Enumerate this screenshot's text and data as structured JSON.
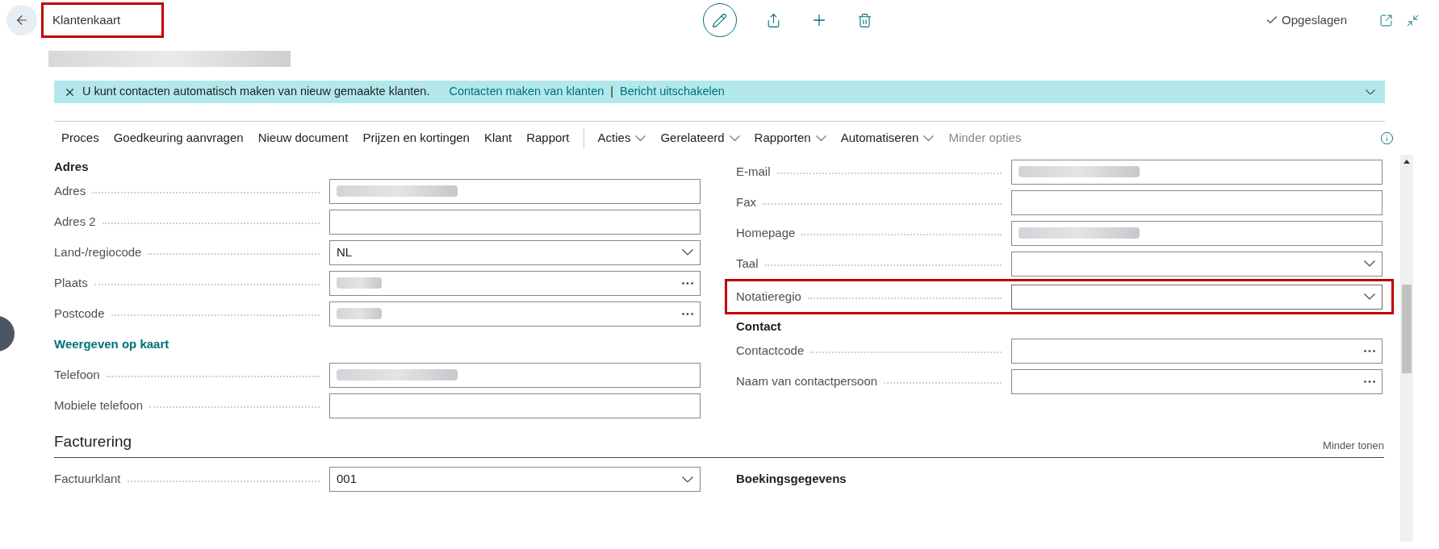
{
  "header": {
    "title": "Klantenkaart",
    "title_highlighted": true,
    "status": "Opgeslagen"
  },
  "notification": {
    "message": "U kunt contacten automatisch maken van nieuw gemaakte klanten.",
    "links": [
      "Contacten maken van klanten",
      "Bericht uitschakelen"
    ],
    "separator": "|"
  },
  "action_bar": [
    {
      "label": "Proces",
      "kind": "plain",
      "disabled": false
    },
    {
      "label": "Goedkeuring aanvragen",
      "kind": "plain",
      "disabled": false
    },
    {
      "label": "Nieuw document",
      "kind": "plain",
      "disabled": false
    },
    {
      "label": "Prijzen en kortingen",
      "kind": "plain",
      "disabled": false
    },
    {
      "label": "Klant",
      "kind": "plain",
      "disabled": false
    },
    {
      "label": "Rapport",
      "kind": "plain",
      "disabled": false
    },
    {
      "label": "Acties",
      "kind": "menu",
      "disabled": false
    },
    {
      "label": "Gerelateerd",
      "kind": "menu",
      "disabled": false
    },
    {
      "label": "Rapporten",
      "kind": "menu",
      "disabled": false
    },
    {
      "label": "Automatiseren",
      "kind": "menu",
      "disabled": false
    },
    {
      "label": "Minder opties",
      "kind": "plain",
      "disabled": true
    }
  ],
  "left_column": [
    {
      "kind": "heading",
      "label": "Adres"
    },
    {
      "kind": "text",
      "label": "Adres",
      "redacted": true,
      "highlighted": false
    },
    {
      "kind": "text",
      "label": "Adres 2",
      "redacted": false,
      "highlighted": false
    },
    {
      "kind": "dropdown",
      "label": "Land-/regiocode",
      "value": "NL",
      "redacted": false,
      "highlighted": false
    },
    {
      "kind": "lookup",
      "label": "Plaats",
      "redacted": true,
      "highlighted": false
    },
    {
      "kind": "lookup",
      "label": "Postcode",
      "redacted": true,
      "highlighted": false
    },
    {
      "kind": "link",
      "label": "Weergeven op kaart"
    },
    {
      "kind": "text",
      "label": "Telefoon",
      "redacted": true,
      "highlighted": false
    },
    {
      "kind": "text",
      "label": "Mobiele telefoon",
      "redacted": false,
      "highlighted": false
    }
  ],
  "right_column": [
    {
      "kind": "text",
      "label": "E-mail",
      "redacted": true,
      "highlighted": false
    },
    {
      "kind": "text",
      "label": "Fax",
      "redacted": false,
      "highlighted": false
    },
    {
      "kind": "text",
      "label": "Homepage",
      "redacted": true,
      "highlighted": false
    },
    {
      "kind": "dropdown",
      "label": "Taal",
      "redacted": false,
      "highlighted": false
    },
    {
      "kind": "dropdown",
      "label": "Notatieregio",
      "redacted": false,
      "highlighted": true
    },
    {
      "kind": "heading",
      "label": "Contact"
    },
    {
      "kind": "lookup",
      "label": "Contactcode",
      "redacted": false,
      "highlighted": false
    },
    {
      "kind": "lookup",
      "label": "Naam van contactpersoon",
      "redacted": false,
      "highlighted": false
    }
  ],
  "billing": {
    "title": "Facturering",
    "toggle": "Minder tonen",
    "field": {
      "kind": "dropdown",
      "label": "Factuurklant",
      "value": "001",
      "redacted": false,
      "highlighted": false
    },
    "right_heading": "Boekingsgegevens"
  }
}
